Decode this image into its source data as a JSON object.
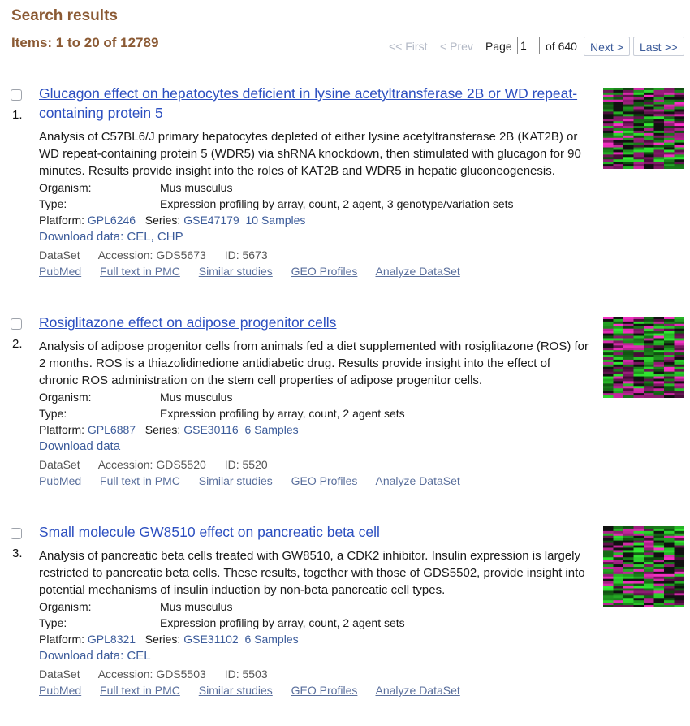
{
  "header": {
    "title": "Search results",
    "items_label": "Items: 1 to 20 of 12789"
  },
  "pager": {
    "first": "<< First",
    "prev": "< Prev",
    "page_label": "Page",
    "page_value": "1",
    "of_label": "of 640",
    "next": "Next >",
    "last": "Last >>"
  },
  "labels": {
    "organism": "Organism:",
    "type": "Type:",
    "platform": "Platform:",
    "series": "Series:",
    "dataset": "DataSet",
    "accession": "Accession:",
    "id": "ID:"
  },
  "records": [
    {
      "number": "1.",
      "title": "Glucagon effect on hepatocytes deficient in lysine acetyltransferase 2B or WD repeat-containing protein 5",
      "summary": "Analysis of C57BL6/J primary hepatocytes depleted of either lysine acetyltransferase 2B (KAT2B) or WD repeat-containing protein 5 (WDR5) via shRNA knockdown, then stimulated with glucagon for 90 minutes. Results provide insight into the roles of KAT2B and WDR5 in hepatic gluconeogenesis.",
      "organism": "Mus musculus",
      "type": "Expression profiling by array, count, 2 agent, 3 genotype/variation sets",
      "platform": "GPL6246",
      "series": "GSE47179",
      "samples": "10 Samples",
      "download": "Download data: CEL, CHP",
      "accession": "GDS5673",
      "id": "5673",
      "links": [
        "PubMed",
        "Full text in PMC",
        "Similar studies",
        "GEO Profiles",
        "Analyze DataSet"
      ]
    },
    {
      "number": "2.",
      "title": "Rosiglitazone effect on adipose progenitor cells",
      "summary": "Analysis of adipose progenitor cells from animals fed a diet supplemented with rosiglitazone (ROS) for 2 months. ROS is a thiazolidinedione antidiabetic drug. Results provide insight into the effect of chronic ROS administration on the stem cell properties of adipose progenitor cells.",
      "organism": "Mus musculus",
      "type": "Expression profiling by array, count, 2 agent sets",
      "platform": "GPL6887",
      "series": "GSE30116",
      "samples": "6 Samples",
      "download": "Download data",
      "accession": "GDS5520",
      "id": "5520",
      "links": [
        "PubMed",
        "Full text in PMC",
        "Similar studies",
        "GEO Profiles",
        "Analyze DataSet"
      ]
    },
    {
      "number": "3.",
      "title": "Small molecule GW8510 effect on pancreatic beta cell",
      "summary": "Analysis of pancreatic beta cells treated with GW8510, a CDK2 inhibitor. Insulin expression is largely restricted to pancreatic beta cells. These results, together with those of GDS5502, provide insight into potential mechanisms of insulin induction by non-beta pancreatic cell types.",
      "organism": "Mus musculus",
      "type": "Expression profiling by array, count, 2 agent sets",
      "platform": "GPL8321",
      "series": "GSE31102",
      "samples": "6 Samples",
      "download": "Download data: CEL",
      "accession": "GDS5503",
      "id": "5503",
      "links": [
        "PubMed",
        "Full text in PMC",
        "Similar studies",
        "GEO Profiles",
        "Analyze DataSet"
      ]
    }
  ],
  "colors": {
    "heading": "#8b5a34",
    "title_link": "#2c4fc0",
    "link": "#3b5b9a",
    "heatmap_high": "#ff33cc",
    "heatmap_low": "#33ee33",
    "heatmap_mid": "#111111"
  }
}
